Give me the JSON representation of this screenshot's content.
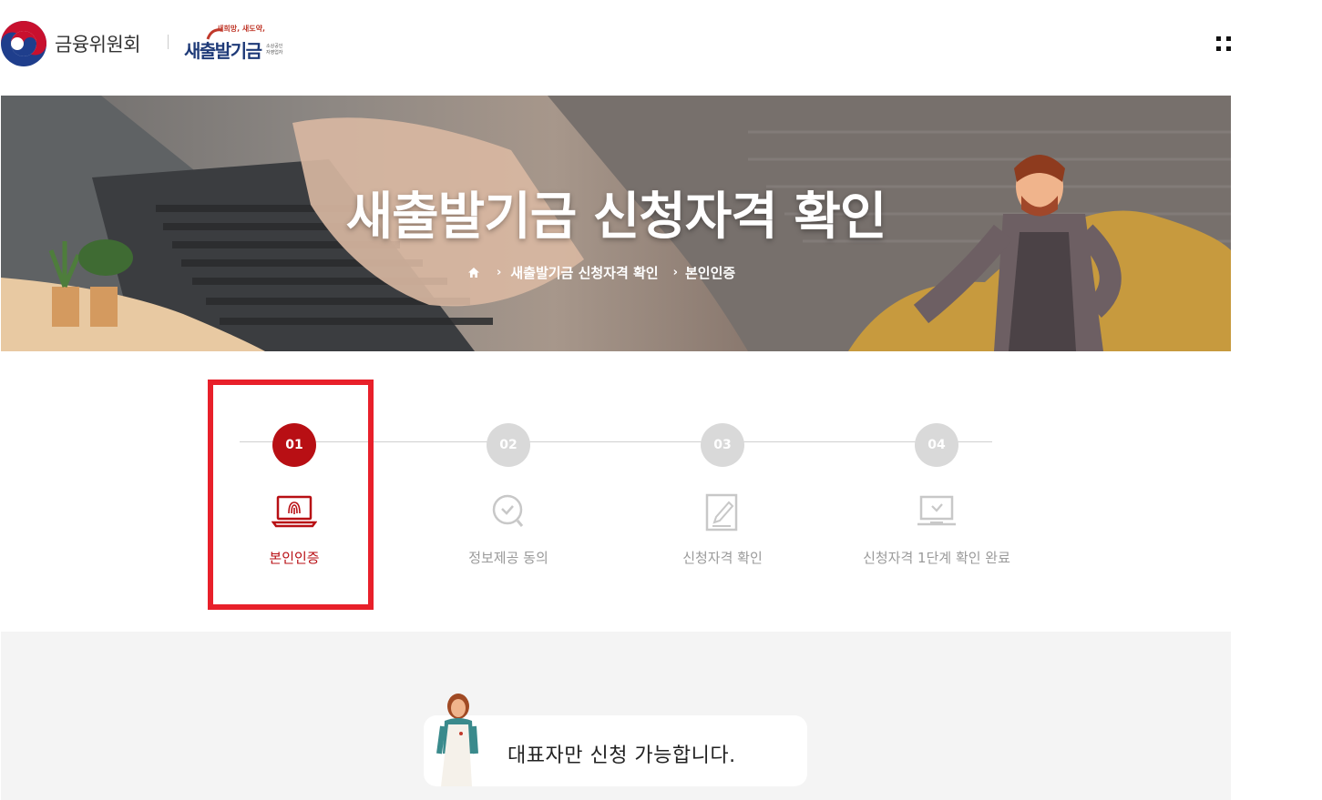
{
  "header": {
    "gov_name": "금융위원회",
    "sub_logo_tag": "새희망, 새도약,",
    "sub_logo_title": "새출발기금",
    "sub_logo_small": "소상공인 자영업자",
    "menu_icon": "grid-menu-icon"
  },
  "hero": {
    "title": "새출발기금 신청자격 확인",
    "breadcrumb": [
      "새출발기금 신청자격 확인",
      "본인인증"
    ],
    "home_icon": "home-icon"
  },
  "steps": [
    {
      "num": "01",
      "label": "본인인증",
      "icon": "laptop-fingerprint-icon",
      "active": true
    },
    {
      "num": "02",
      "label": "정보제공 동의",
      "icon": "search-check-icon",
      "active": false
    },
    {
      "num": "03",
      "label": "신청자격 확인",
      "icon": "document-edit-icon",
      "active": false
    },
    {
      "num": "04",
      "label": "신청자격 1단계 확인 완료",
      "icon": "monitor-check-icon",
      "active": false
    }
  ],
  "notice": {
    "text": "대표자만 신청 가능합니다."
  },
  "colors": {
    "accent": "#b80f14",
    "highlight": "#e8202a",
    "inactive": "#d9d9d9",
    "brand_navy": "#1e3a78"
  }
}
